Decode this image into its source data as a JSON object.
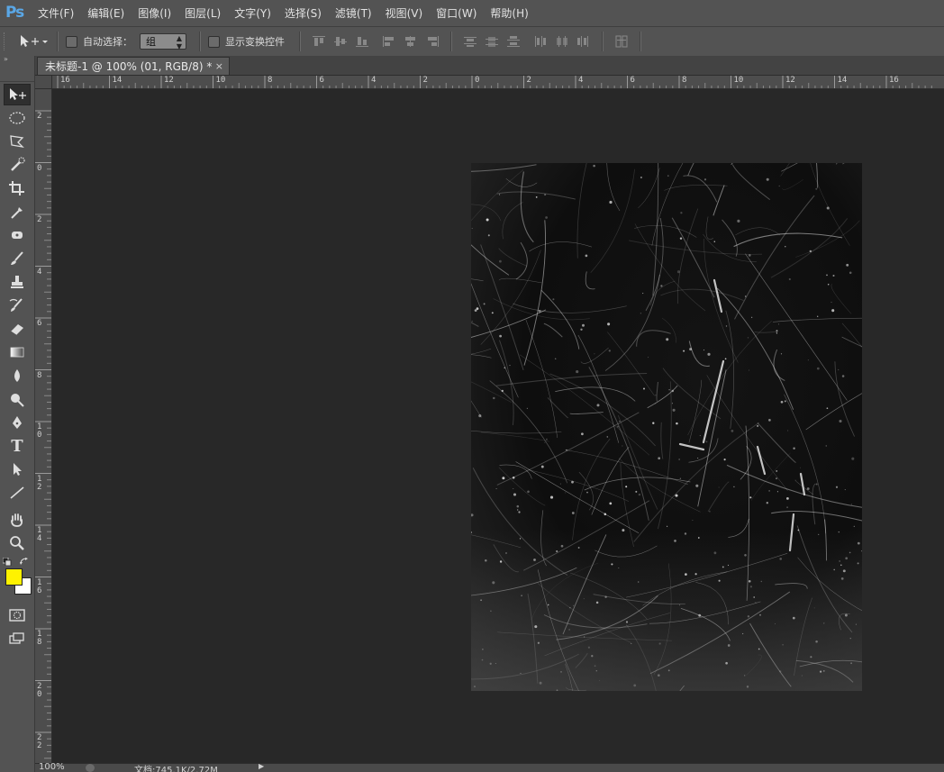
{
  "app": {
    "logo": "Ps",
    "menu": [
      "文件(F)",
      "编辑(E)",
      "图像(I)",
      "图层(L)",
      "文字(Y)",
      "选择(S)",
      "滤镜(T)",
      "视图(V)",
      "窗口(W)",
      "帮助(H)"
    ]
  },
  "options": {
    "auto_select_label": "自动选择：",
    "auto_select_value": "组",
    "show_transform_label": "显示变换控件"
  },
  "document": {
    "tab_title": "未标题-1 @ 100% (01, RGB/8) *",
    "close_glyph": "×"
  },
  "rulers": {
    "horizontal": [
      "16",
      "14",
      "12",
      "10",
      "8",
      "6",
      "4",
      "2",
      "0",
      "2",
      "4",
      "6",
      "8",
      "10",
      "12",
      "14",
      "16"
    ],
    "vertical": [
      "2",
      "0",
      "2",
      "4",
      "6",
      "8",
      "10",
      "12",
      "14",
      "16",
      "18",
      "20",
      "22"
    ]
  },
  "tools": [
    {
      "name": "move-tool-icon",
      "active": true
    },
    {
      "name": "elliptical-marquee-tool-icon"
    },
    {
      "name": "polygonal-lasso-tool-icon"
    },
    {
      "name": "quick-selection-tool-icon"
    },
    {
      "name": "crop-tool-icon"
    },
    {
      "name": "eyedropper-tool-icon"
    },
    {
      "name": "spot-healing-brush-tool-icon"
    },
    {
      "name": "brush-tool-icon"
    },
    {
      "name": "clone-stamp-tool-icon"
    },
    {
      "name": "history-brush-tool-icon"
    },
    {
      "name": "eraser-tool-icon"
    },
    {
      "name": "gradient-tool-icon"
    },
    {
      "name": "blur-tool-icon"
    },
    {
      "name": "dodge-tool-icon"
    },
    {
      "name": "pen-tool-icon"
    },
    {
      "name": "type-tool-icon",
      "glyph": "T"
    },
    {
      "name": "path-selection-tool-icon"
    },
    {
      "name": "line-tool-icon"
    },
    {
      "name": "hand-tool-icon"
    },
    {
      "name": "zoom-tool-icon"
    }
  ],
  "colors": {
    "foreground": "#fff200",
    "background": "#ffffff",
    "workspace": "#282828",
    "ui": "#535353"
  },
  "status": {
    "zoom": "100%",
    "doc_info": "文档:745.1K/2.72M"
  }
}
